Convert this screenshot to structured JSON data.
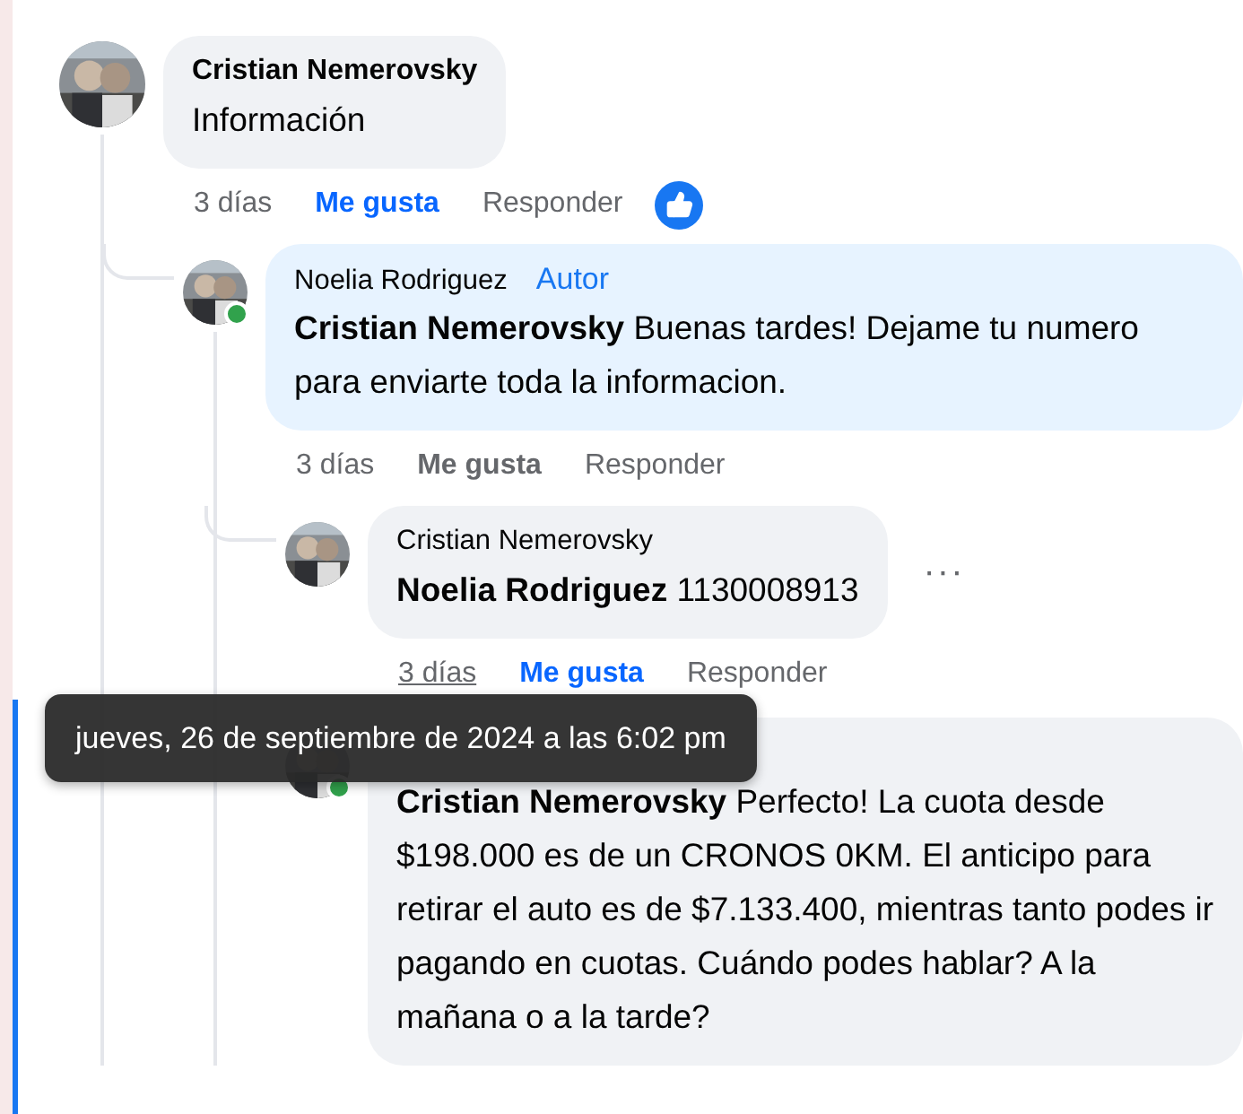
{
  "comments": [
    {
      "author": "Cristian Nemerovsky",
      "text": "Información",
      "time": "3 días",
      "time_hovered": false,
      "like_label": "Me gusta",
      "liked": true,
      "reply_label": "Responder",
      "like_reaction": true,
      "children": [
        {
          "author": "Noelia Rodriguez",
          "author_badge": "Autor",
          "text": "**Cristian Nemerovsky** Buenas tardes! Dejame tu numero para enviarte toda la informacion.",
          "online": true,
          "time": "3 días",
          "time_hovered": false,
          "like_label": "Me gusta",
          "liked": false,
          "reply_label": "Responder",
          "children": [
            {
              "author": "Cristian Nemerovsky",
              "text": "**Noelia Rodriguez** 1130008913",
              "time": "3 días",
              "time_hovered": true,
              "like_label": "Me gusta",
              "liked": true,
              "reply_label": "Responder",
              "menu": "···"
            },
            {
              "text": "**Cristian Nemerovsky** Perfecto! La cuota desde $198.000 es de un CRONOS 0KM. El anticipo para retirar el auto es de $7.133.400, mientras tanto podes ir pagando en cuotas. Cuándo podes hablar? A la mañana o a la tarde?",
              "online": true
            }
          ]
        }
      ]
    }
  ],
  "tooltip": {
    "text": "jueves, 26 de septiembre de 2024 a las 6:02 pm"
  }
}
